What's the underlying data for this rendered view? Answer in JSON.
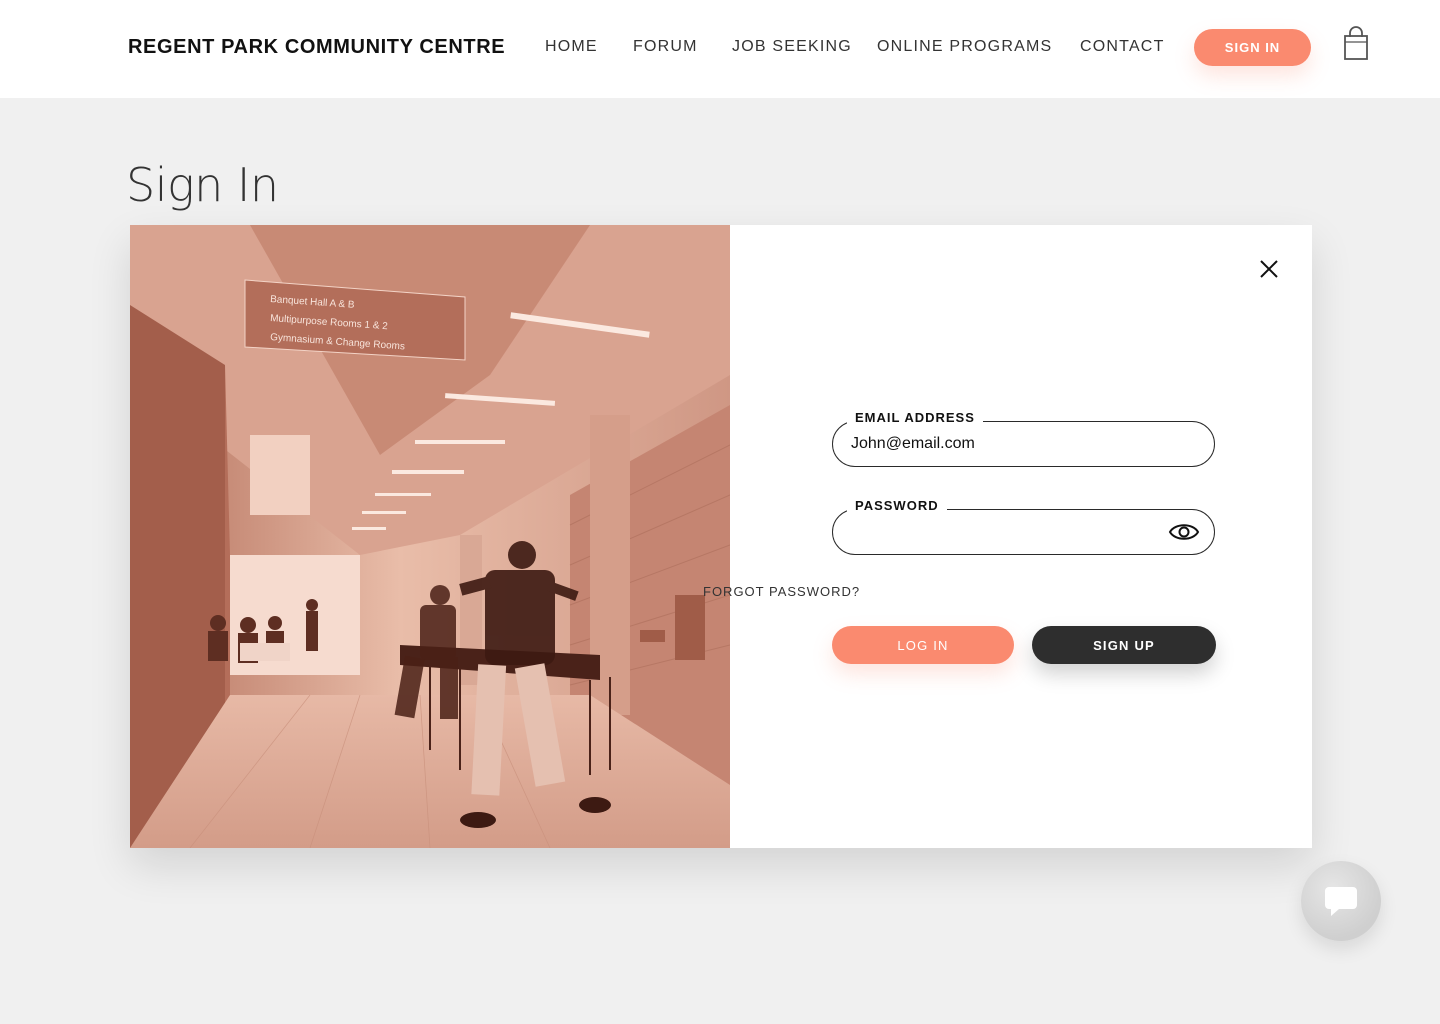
{
  "header": {
    "brand": "REGENT PARK COMMUNITY CENTRE",
    "nav": [
      {
        "label": "HOME"
      },
      {
        "label": "FORUM"
      },
      {
        "label": "JOB SEEKING"
      },
      {
        "label": "ONLINE PROGRAMS"
      },
      {
        "label": "CONTACT"
      }
    ],
    "signin_label": "SIGN IN",
    "cart_icon": "shopping-bag-icon"
  },
  "page": {
    "title": "Sign In"
  },
  "modal": {
    "photo_signage": [
      "Banquet Hall A & B",
      "Multipurpose Rooms 1 & 2",
      "Gymnasium & Change Rooms"
    ],
    "close_icon": "close-icon",
    "email": {
      "label": "EMAIL ADDRESS",
      "value": "John@email.com"
    },
    "password": {
      "label": "PASSWORD",
      "value": "",
      "toggle_icon": "eye-icon"
    },
    "forgot_label": "FORGOT PASSWORD?",
    "login_label": "LOG IN",
    "signup_label": "SIGN UP"
  },
  "chat": {
    "icon": "chat-bubble-icon"
  },
  "colors": {
    "accent": "#fa8a6f",
    "dark_button": "#2e2e2e",
    "page_background": "#f0f0f0",
    "photo_tint": "#c98a76"
  }
}
